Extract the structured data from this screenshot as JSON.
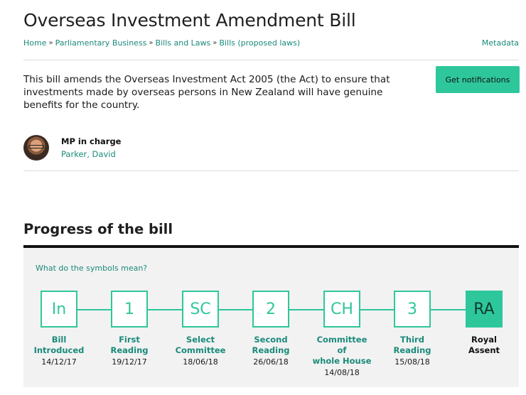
{
  "page": {
    "title": "Overseas Investment Amendment Bill",
    "metadata_link": "Metadata"
  },
  "breadcrumb": [
    {
      "label": "Home"
    },
    {
      "label": "Parliamentary Business"
    },
    {
      "label": "Bills and Laws"
    },
    {
      "label": "Bills (proposed laws)"
    }
  ],
  "breadcrumb_separator": "»",
  "summary": {
    "text": "This bill amends the Overseas Investment Act 2005 (the Act) to ensure that investments made by overseas persons in New Zealand will have genuine benefits for the country.",
    "notify_button": "Get notifications"
  },
  "mp": {
    "role": "MP in charge",
    "name": "Parker, David"
  },
  "progress": {
    "title": "Progress of the bill",
    "symbols_link": "What do the symbols mean?",
    "stages": [
      {
        "abbr": "In",
        "label_lines": [
          "Bill",
          "Introduced"
        ],
        "date": "14/12/17",
        "complete": false
      },
      {
        "abbr": "1",
        "label_lines": [
          "First",
          "Reading"
        ],
        "date": "19/12/17",
        "complete": false
      },
      {
        "abbr": "SC",
        "label_lines": [
          "Select",
          "Committee"
        ],
        "date": "18/06/18",
        "complete": false
      },
      {
        "abbr": "2",
        "label_lines": [
          "Second",
          "Reading"
        ],
        "date": "26/06/18",
        "complete": false
      },
      {
        "abbr": "CH",
        "label_lines": [
          "Committee",
          "of",
          "whole House"
        ],
        "date": "14/08/18",
        "complete": false
      },
      {
        "abbr": "3",
        "label_lines": [
          "Third",
          "Reading"
        ],
        "date": "15/08/18",
        "complete": false
      },
      {
        "abbr": "RA",
        "label_lines": [
          "Royal",
          "Assent"
        ],
        "date": "",
        "complete": true
      }
    ]
  },
  "colors": {
    "accent": "#2ec79b",
    "link": "#1a8a7a"
  }
}
